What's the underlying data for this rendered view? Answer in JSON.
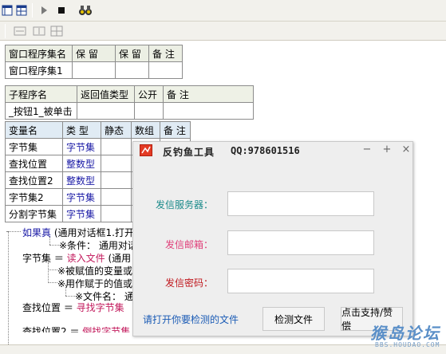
{
  "toolbar": {
    "icons": [
      "layout-icon",
      "table-icon",
      "run-icon",
      "stop-icon",
      "binoculars-icon"
    ],
    "row2_icons": [
      "width-icon",
      "height-icon",
      "grid-icon"
    ]
  },
  "table_assembly": {
    "headers": [
      "窗口程序集名",
      "保 留",
      "保 留",
      "备 注"
    ],
    "rows": [
      [
        "窗口程序集1",
        "",
        "",
        ""
      ]
    ]
  },
  "table_sub": {
    "headers": [
      "子程序名",
      "返回值类型",
      "公开",
      "备 注"
    ],
    "rows": [
      [
        "_按钮1_被单击",
        "",
        "",
        ""
      ]
    ]
  },
  "table_vars": {
    "headers": [
      "变量名",
      "类 型",
      "静态",
      "数组",
      "备 注"
    ],
    "rows": [
      [
        "字节集",
        "字节集",
        "",
        "",
        ""
      ],
      [
        "查找位置",
        "整数型",
        "",
        "",
        ""
      ],
      [
        "查找位置2",
        "整数型",
        "",
        "",
        ""
      ],
      [
        "字节集2",
        "字节集",
        "",
        "",
        ""
      ],
      [
        "分割字节集",
        "字节集",
        "",
        "",
        ""
      ]
    ]
  },
  "code": {
    "line1_kw": "如果真",
    "line1_rest": "(通用对话框1.打开",
    "line2": "※条件： 通用对话",
    "line3_var": "字节集 ＝",
    "line3_fn": "读入文件",
    "line3_rest": "(通用",
    "line4": "※被赋值的变量或",
    "line5": "※用作赋于的值或",
    "line6": "※文件名：  通",
    "line7_var": "查找位置 ＝",
    "line7_fn": "寻找字节集",
    "line8_var": "查找位置2 ＝",
    "line8_fn": "倒找字节集"
  },
  "dialog": {
    "title": "反钓鱼工具",
    "qq": "QQ:978601516",
    "controls": [
      "−",
      "+",
      "×"
    ],
    "label_server": "发信服务器：",
    "label_mail": "发信邮箱：",
    "label_pass": "发信密码：",
    "link_text": "请打开你要检测的文件",
    "btn_detect": "检测文件",
    "btn_support": "点击支持/赞偿",
    "colors": {
      "server": "#1a8a8a",
      "mail": "#e0407a",
      "pass": "#c0181e",
      "link": "#1a5bb5"
    }
  },
  "watermark": {
    "main": "猴岛论坛",
    "sub": "BBS.HOUDAO.COM"
  }
}
